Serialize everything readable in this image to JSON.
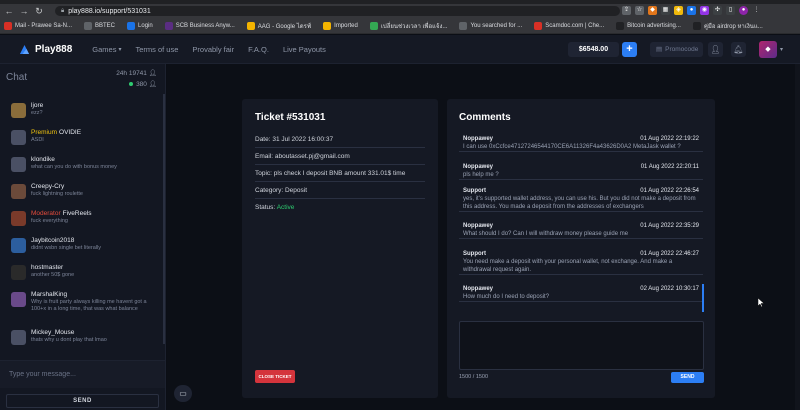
{
  "browser": {
    "url": "play888.io/support/531031",
    "lock_icon": "lock-icon",
    "bookmarks": [
      {
        "label": "Mail - Prawee Sa-N...",
        "color": "#d93025"
      },
      {
        "label": "BBTEC",
        "color": "#5f6368"
      },
      {
        "label": "Login",
        "color": "#1a73e8"
      },
      {
        "label": "SCB Business Anyw...",
        "color": "#5a2d82"
      },
      {
        "label": "AAG - Google ไดรฟ์",
        "color": "#f4b400"
      },
      {
        "label": "Imported",
        "color": "#f4b400"
      },
      {
        "label": "เปลี่ยนช่วงเวลา เพื่อแจ้ง...",
        "color": "#34a853"
      },
      {
        "label": "You searched for ...",
        "color": "#5f6368"
      },
      {
        "label": "Scamdoc.com | Che...",
        "color": "#d93025"
      },
      {
        "label": "Bitcoin advertising...",
        "color": "#202124"
      },
      {
        "label": "คู่มือ airdrop หาเงินแ...",
        "color": "#202124"
      }
    ]
  },
  "header": {
    "brand": "Play888",
    "nav": {
      "games": "Games",
      "terms": "Terms of use",
      "fair": "Provably fair",
      "faq": "F.A.Q.",
      "live": "Live Payouts"
    },
    "balance": "$6548.00",
    "plus": "+",
    "promocode": "Promocode",
    "accent": "#2c7ef4"
  },
  "chat": {
    "title": "Chat",
    "online_24h": "24h 19741",
    "online_now": "380",
    "messages": [
      {
        "name": "ljore",
        "rank": "",
        "text": "ezz?",
        "avatar": "#8a6d3b"
      },
      {
        "name": "OVIDIE",
        "rank": "Premium",
        "text": "ASDI",
        "avatar": "#4a5064"
      },
      {
        "name": "klondike",
        "rank": "",
        "text": "what can you do with bonus money",
        "avatar": "#4a5064"
      },
      {
        "name": "Creepy-Cry",
        "rank": "",
        "text": "fuck lightning roulette",
        "avatar": "#6b4a3a"
      },
      {
        "name": "FiveReels",
        "rank": "Moderator",
        "text": "fuck everything",
        "avatar": "#7a3a2a"
      },
      {
        "name": "Jaybitcoin2018",
        "rank": "",
        "text": "didnt wsbn single bet literally",
        "avatar": "#2c5e9e"
      },
      {
        "name": "hostmaster",
        "rank": "",
        "text": "another 50$ gone",
        "avatar": "#2a2a2a"
      },
      {
        "name": "MarshalKing",
        "rank": "",
        "text": "Why is fruit party always killing me havent got a 100+x in a long time, that was what balance",
        "avatar": "#6a4a8a"
      },
      {
        "name": "Mickey_Mouse",
        "rank": "",
        "text": "thats why u dont play that lmao",
        "avatar": "#4a5064"
      }
    ],
    "input_placeholder": "Type your message...",
    "send": "SEND",
    "colors": {
      "premium": "#f1c40f",
      "moderator": "#e74c3c"
    }
  },
  "ticket": {
    "title": "Ticket #531031",
    "date": "Date: 31 Jul 2022 16:00:37",
    "email": "Email: aboutasset.pj@gmail.com",
    "topic": "Topic: pls check I deposit BNB amount 331.01$ time",
    "category": "Category: Deposit",
    "status_label": "Status: ",
    "status_value": "Active",
    "close": "CLOSE TICKET"
  },
  "comments": {
    "title": "Comments",
    "items": [
      {
        "author": "Noppawey",
        "time": "01 Aug 2022 22:19:22",
        "text": "I can use 0xCcfce47127246544170CE6A11326F4a43626D0A2 MetaJask wallet ?"
      },
      {
        "author": "Noppawey",
        "time": "01 Aug 2022 22:20:11",
        "text": "pls help me ?"
      },
      {
        "author": "Support",
        "time": "01 Aug 2022 22:26:54",
        "text": "yes, it's supported wallet address, you can use his. But you did not make a deposit from this address. You made a deposit from the addresses of exchangers"
      },
      {
        "author": "Noppawey",
        "time": "01 Aug 2022 22:35:29",
        "text": "What should I do? Can I will withdraw money please guide me"
      },
      {
        "author": "Support",
        "time": "01 Aug 2022 22:46:27",
        "text": "You need make a deposit with your personal wallet, not exchange. And make a withdrawal request again."
      },
      {
        "author": "Noppawey",
        "time": "02 Aug 2022 10:30:17",
        "text": "How much do I need to deposit?"
      }
    ],
    "reply_value": "",
    "counter": "1500 / 1500",
    "send": "SEND"
  }
}
